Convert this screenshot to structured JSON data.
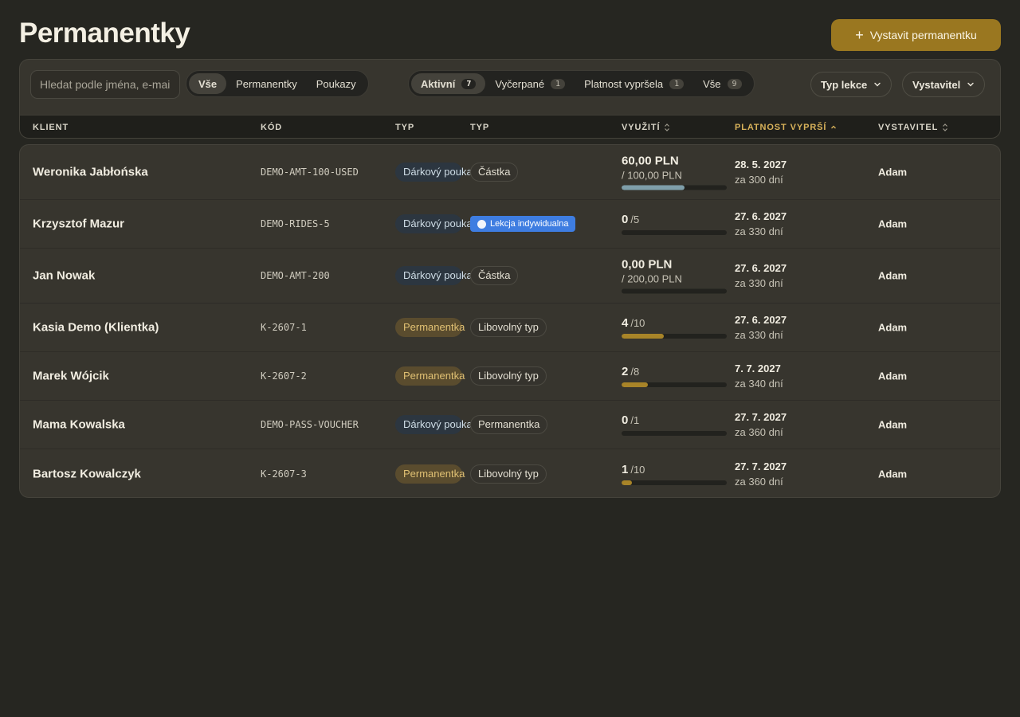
{
  "header": {
    "title": "Permanentky",
    "create_button_label": "Vystavit permanentku",
    "create_button_icon": "plus-icon"
  },
  "filters": {
    "search_placeholder": "Hledat podle jména, e-mailu…",
    "kind_tabs": [
      {
        "label": "Vše",
        "active": true
      },
      {
        "label": "Permanentky",
        "active": false
      },
      {
        "label": "Poukazy",
        "active": false
      }
    ],
    "status_tabs": [
      {
        "label": "Aktivní",
        "count": "7",
        "active": true
      },
      {
        "label": "Vyčerpané",
        "count": "1",
        "active": false
      },
      {
        "label": "Platnost vypršela",
        "count": "1",
        "active": false
      },
      {
        "label": "Vše",
        "count": "9",
        "active": false
      }
    ],
    "lesson_type_dropdown": "Typ lekce",
    "issuer_dropdown": "Vystavitel"
  },
  "table": {
    "columns": {
      "client": "KLIENT",
      "code": "KÓD",
      "type": "TYP",
      "type2": "TYP",
      "usage": "VYUŽITÍ",
      "expiry": "PLATNOST VYPRŠÍ",
      "issuer": "VYSTAVITEL"
    },
    "sorted_column": "expiry",
    "sort_direction": "ascending",
    "rows": [
      {
        "client": "Weronika Jabłońska",
        "code": "DEMO-AMT-100-USED",
        "type": "Dárkový poukaz",
        "type_kind": "voucher",
        "lesson": "Částka",
        "lesson_style": "outline",
        "usage_main": "60,00 PLN",
        "usage_sub": "",
        "usage_total": "/ 100,00 PLN",
        "usage_fraction": 0.6,
        "bar_color": "#7e9ea9",
        "expiry_date": "28. 5. 2027",
        "expiry_rel": "za 300 dní",
        "issuer": "Adam"
      },
      {
        "client": "Krzysztof Mazur",
        "code": "DEMO-RIDES-5",
        "type": "Dárkový poukaz",
        "type_kind": "voucher",
        "lesson": "Lekcja indywidualna",
        "lesson_style": "blue",
        "usage_main": "0",
        "usage_sub": "/5",
        "usage_total": "",
        "usage_fraction": 0,
        "bar_color": "#a88428",
        "expiry_date": "27. 6. 2027",
        "expiry_rel": "za 330 dní",
        "issuer": "Adam"
      },
      {
        "client": "Jan Nowak",
        "code": "DEMO-AMT-200",
        "type": "Dárkový poukaz",
        "type_kind": "voucher",
        "lesson": "Částka",
        "lesson_style": "outline",
        "usage_main": "0,00 PLN",
        "usage_sub": "",
        "usage_total": "/ 200,00 PLN",
        "usage_fraction": 0,
        "bar_color": "#7e9ea9",
        "expiry_date": "27. 6. 2027",
        "expiry_rel": "za 330 dní",
        "issuer": "Adam"
      },
      {
        "client": "Kasia Demo (Klientka)",
        "code": "K-2607-1",
        "type": "Permanentka",
        "type_kind": "pass",
        "lesson": "Libovolný typ",
        "lesson_style": "outline",
        "usage_main": "4",
        "usage_sub": "/10",
        "usage_total": "",
        "usage_fraction": 0.4,
        "bar_color": "#a88428",
        "expiry_date": "27. 6. 2027",
        "expiry_rel": "za 330 dní",
        "issuer": "Adam"
      },
      {
        "client": "Marek Wójcik",
        "code": "K-2607-2",
        "type": "Permanentka",
        "type_kind": "pass",
        "lesson": "Libovolný typ",
        "lesson_style": "outline",
        "usage_main": "2",
        "usage_sub": "/8",
        "usage_total": "",
        "usage_fraction": 0.25,
        "bar_color": "#a88428",
        "expiry_date": "7. 7. 2027",
        "expiry_rel": "za 340 dní",
        "issuer": "Adam"
      },
      {
        "client": "Mama Kowalska",
        "code": "DEMO-PASS-VOUCHER",
        "type": "Dárkový poukaz",
        "type_kind": "voucher",
        "lesson": "Permanentka",
        "lesson_style": "outline",
        "usage_main": "0",
        "usage_sub": "/1",
        "usage_total": "",
        "usage_fraction": 0,
        "bar_color": "#a88428",
        "expiry_date": "27. 7. 2027",
        "expiry_rel": "za 360 dní",
        "issuer": "Adam"
      },
      {
        "client": "Bartosz Kowalczyk",
        "code": "K-2607-3",
        "type": "Permanentka",
        "type_kind": "pass",
        "lesson": "Libovolný typ",
        "lesson_style": "outline",
        "usage_main": "1",
        "usage_sub": "/10",
        "usage_total": "",
        "usage_fraction": 0.1,
        "bar_color": "#a88428",
        "expiry_date": "27. 7. 2027",
        "expiry_rel": "za 360 dní",
        "issuer": "Adam"
      }
    ]
  }
}
